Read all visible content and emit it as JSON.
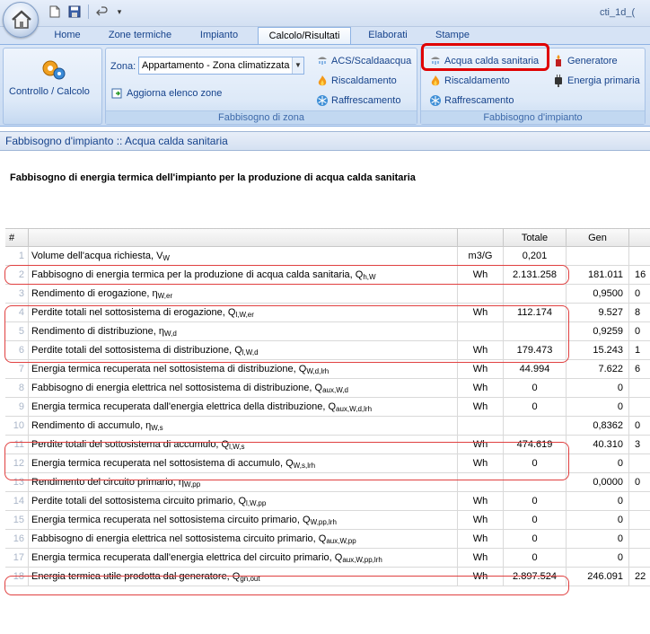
{
  "window": {
    "title": "cti_1d_("
  },
  "tabs": [
    {
      "label": "Home"
    },
    {
      "label": "Zone termiche"
    },
    {
      "label": "Impianto"
    },
    {
      "label": "Calcolo/Risultati"
    },
    {
      "label": "Elaborati"
    },
    {
      "label": "Stampe"
    }
  ],
  "ribbon": {
    "controllo_label": "Controllo / Calcolo",
    "zona_label": "Zona:",
    "zona_value": "Appartamento - Zona climatizzata",
    "aggiorna_label": "Aggiorna elenco zone",
    "zone_group": {
      "acs": "ACS/Scaldaacqua",
      "riscaldamento": "Riscaldamento",
      "raffrescamento": "Raffrescamento",
      "label": "Fabbisogno di zona"
    },
    "impianto_group": {
      "acqua": "Acqua calda sanitaria",
      "riscaldamento": "Riscaldamento",
      "raffrescamento": "Raffrescamento",
      "generatore": "Generatore",
      "energia_primaria": "Energia primaria",
      "label": "Fabbisogno d'impianto"
    }
  },
  "panel": {
    "header": "Fabbisogno d'impianto :: Acqua calda sanitaria",
    "title": "Fabbisogno di energia termica dell'impianto per la produzione di acqua calda sanitaria"
  },
  "table": {
    "headers": {
      "num": "#",
      "totale": "Totale",
      "gen": "Gen"
    },
    "rows": [
      {
        "n": "1",
        "d": "Volume dell'acqua richiesta, V",
        "s": "W",
        "u": "m3/G",
        "t": "0,201",
        "g": "",
        "e": ""
      },
      {
        "n": "2",
        "d": "Fabbisogno di energia termica per la produzione di acqua calda sanitaria, Q",
        "s": "h,W",
        "u": "Wh",
        "t": "2.131.258",
        "g": "181.011",
        "e": "16"
      },
      {
        "n": "3",
        "d": "Rendimento di erogazione, η",
        "s": "W,er",
        "u": "",
        "t": "",
        "g": "0,9500",
        "e": "0"
      },
      {
        "n": "4",
        "d": "Perdite totali nel sottosistema di erogazione, Q",
        "s": "l,W,er",
        "u": "Wh",
        "t": "112.174",
        "g": "9.527",
        "e": "8"
      },
      {
        "n": "5",
        "d": "Rendimento di distribuzione, η",
        "s": "W,d",
        "u": "",
        "t": "",
        "g": "0,9259",
        "e": "0"
      },
      {
        "n": "6",
        "d": "Perdite totali del sottosistema di distribuzione, Q",
        "s": "l,W,d",
        "u": "Wh",
        "t": "179.473",
        "g": "15.243",
        "e": "1"
      },
      {
        "n": "7",
        "d": "Energia termica recuperata nel sottosistema di distribuzione, Q",
        "s": "W,d,lrh",
        "u": "Wh",
        "t": "44.994",
        "g": "7.622",
        "e": "6"
      },
      {
        "n": "8",
        "d": "Fabbisogno di energia elettrica nel sottosistema di distribuzione, Q",
        "s": "aux,W,d",
        "u": "Wh",
        "t": "0",
        "g": "0",
        "e": ""
      },
      {
        "n": "9",
        "d": "Energia termica recuperata dall'energia elettrica della distribuzione, Q",
        "s": "aux,W,d,lrh",
        "u": "Wh",
        "t": "0",
        "g": "0",
        "e": ""
      },
      {
        "n": "10",
        "d": "Rendimento di accumulo, η",
        "s": "W,s",
        "u": "",
        "t": "",
        "g": "0,8362",
        "e": "0"
      },
      {
        "n": "11",
        "d": "Perdite totali del sottosistema di accumulo, Q",
        "s": "l,W,s",
        "u": "Wh",
        "t": "474.619",
        "g": "40.310",
        "e": "3"
      },
      {
        "n": "12",
        "d": "Energia termica recuperata nel sottosistema di accumulo, Q",
        "s": "W,s,lrh",
        "u": "Wh",
        "t": "0",
        "g": "0",
        "e": ""
      },
      {
        "n": "13",
        "d": "Rendimento del circuito primario, η",
        "s": "W,pp",
        "u": "",
        "t": "",
        "g": "0,0000",
        "e": "0"
      },
      {
        "n": "14",
        "d": "Perdite totali del sottosistema circuito primario, Q",
        "s": "l,W,pp",
        "u": "Wh",
        "t": "0",
        "g": "0",
        "e": ""
      },
      {
        "n": "15",
        "d": "Energia termica recuperata nel sottosistema circuito primario, Q",
        "s": "W,pp,lrh",
        "u": "Wh",
        "t": "0",
        "g": "0",
        "e": ""
      },
      {
        "n": "16",
        "d": "Fabbisogno di energia elettrica nel sottosistema circuito primario, Q",
        "s": "aux,W,pp",
        "u": "Wh",
        "t": "0",
        "g": "0",
        "e": ""
      },
      {
        "n": "17",
        "d": "Energia termica recuperata dall'energia elettrica del circuito primario, Q",
        "s": "aux,W,pp,lrh",
        "u": "Wh",
        "t": "0",
        "g": "0",
        "e": ""
      },
      {
        "n": "18",
        "d": "Energia termica utile prodotta dal generatore, Q",
        "s": "gn,out",
        "u": "Wh",
        "t": "2.897.524",
        "g": "246.091",
        "e": "22"
      }
    ]
  },
  "colors": {
    "accent": "#15428b",
    "highlight": "#e00000"
  }
}
